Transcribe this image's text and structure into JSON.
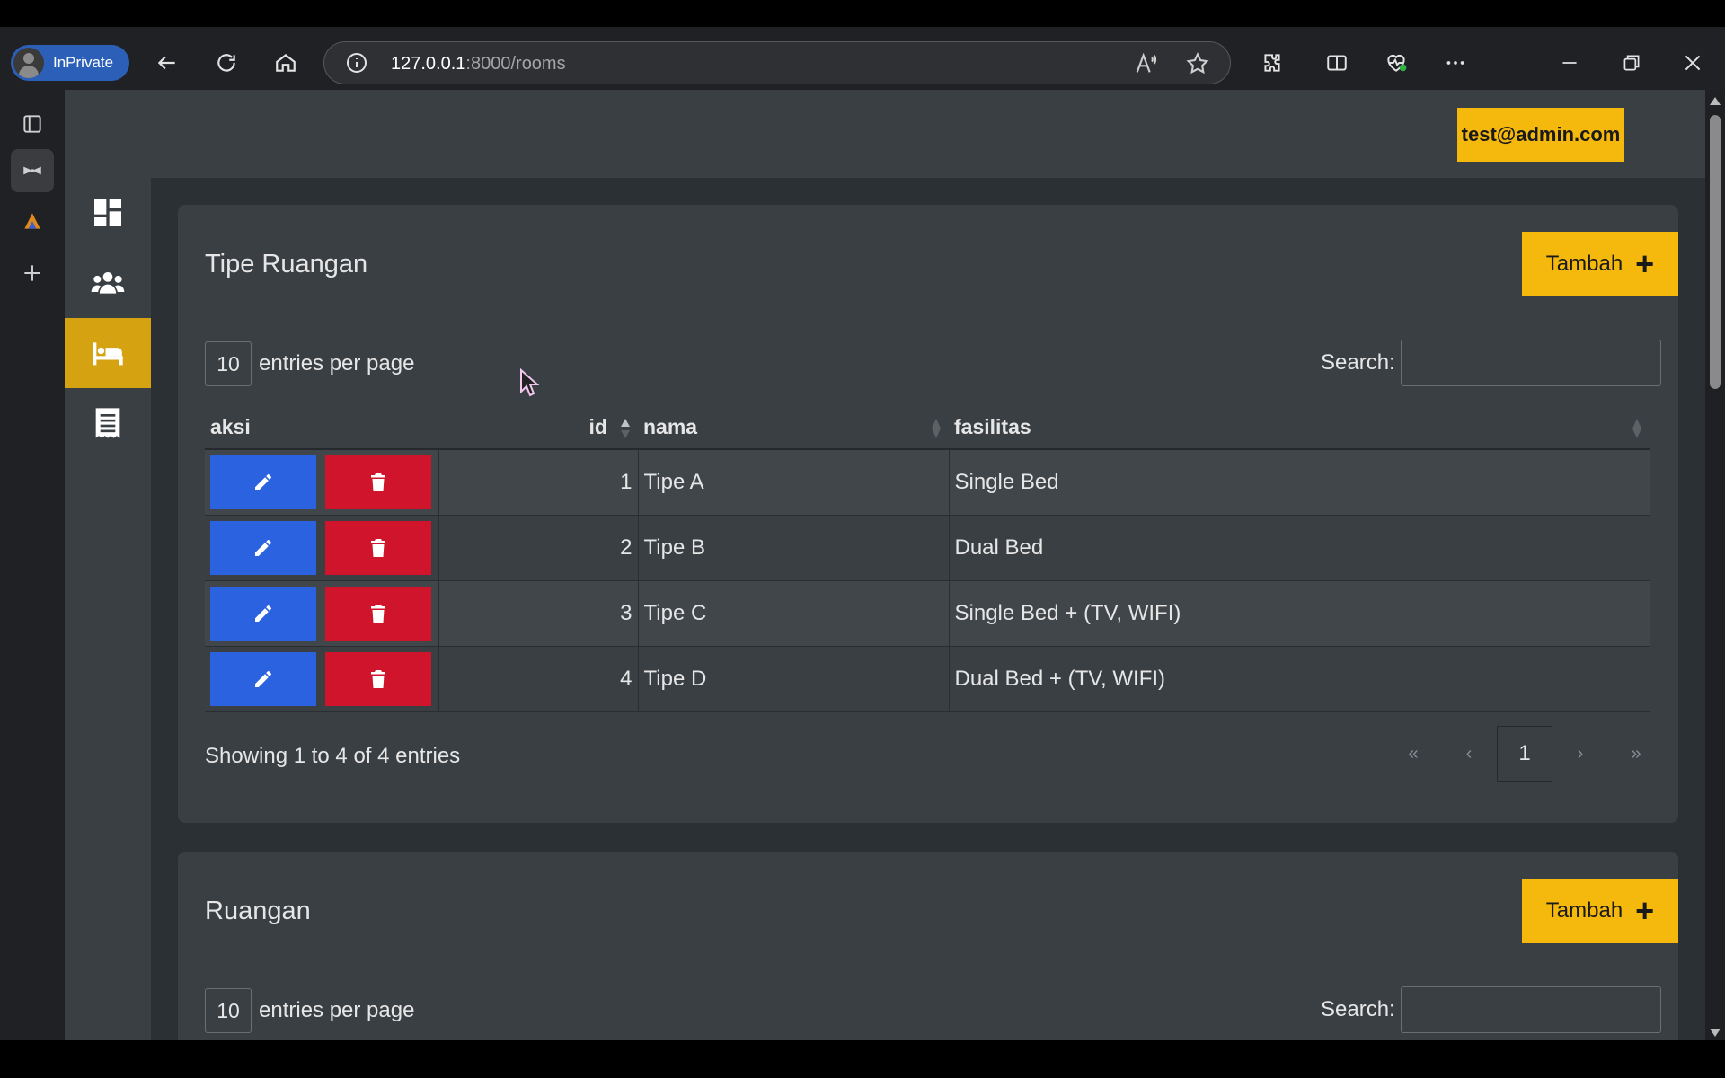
{
  "browser": {
    "inprivate_label": "InPrivate",
    "url_host": "127.0.0.1",
    "url_path": ":8000/rooms",
    "read_aloud_label": "A¹¹"
  },
  "header": {
    "user_email": "test@admin.com"
  },
  "sidebar": {
    "items": [
      {
        "name": "dashboard",
        "icon": "dashboard-icon"
      },
      {
        "name": "users",
        "icon": "users-icon"
      },
      {
        "name": "rooms",
        "icon": "bed-icon",
        "active": true
      },
      {
        "name": "reports",
        "icon": "receipt-icon"
      }
    ]
  },
  "tipe_card": {
    "title": "Tipe Ruangan",
    "add_label": "Tambah",
    "add_icon": "plus-icon",
    "entries_value": "10",
    "entries_label": "entries per page",
    "search_label": "Search:",
    "columns": [
      "aksi",
      "id",
      "nama",
      "fasilitas"
    ],
    "rows": [
      {
        "id": "1",
        "nama": "Tipe A",
        "fasilitas": "Single Bed"
      },
      {
        "id": "2",
        "nama": "Tipe B",
        "fasilitas": "Dual Bed"
      },
      {
        "id": "3",
        "nama": "Tipe C",
        "fasilitas": "Single Bed + (TV, WIFI)"
      },
      {
        "id": "4",
        "nama": "Tipe D",
        "fasilitas": "Dual Bed + (TV, WIFI)"
      }
    ],
    "info": "Showing 1 to 4 of 4 entries",
    "pager": {
      "first": "«",
      "prev": "‹",
      "current": "1",
      "next": "›",
      "last": "»"
    }
  },
  "ruangan_card": {
    "title": "Ruangan",
    "add_label": "Tambah",
    "entries_value": "10",
    "entries_label": "entries per page",
    "search_label": "Search:"
  },
  "colors": {
    "accent": "#f5b80c",
    "edit": "#2b62e0",
    "delete": "#d0142b",
    "card_bg": "#3a3f44"
  }
}
